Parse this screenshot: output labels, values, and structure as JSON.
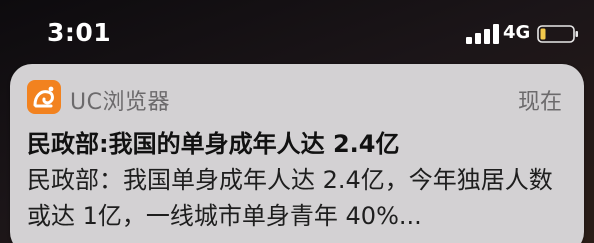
{
  "status_bar": {
    "time": "3:01",
    "network": "4G"
  },
  "notification": {
    "app_icon": "uc-browser-squirrel-icon",
    "app_name": "UC浏览器",
    "timestamp": "现在",
    "title": "民政部:我国的单身成年人达 2.4亿",
    "body": "民政部：我国单身成年人达 2.4亿，今年独居人数或达 1亿，一线城市单身青年 40%..."
  },
  "colors": {
    "card_background": "#d3d1d3",
    "app_icon_orange": "#f2821f",
    "secondary_text": "#6c6a6c"
  }
}
